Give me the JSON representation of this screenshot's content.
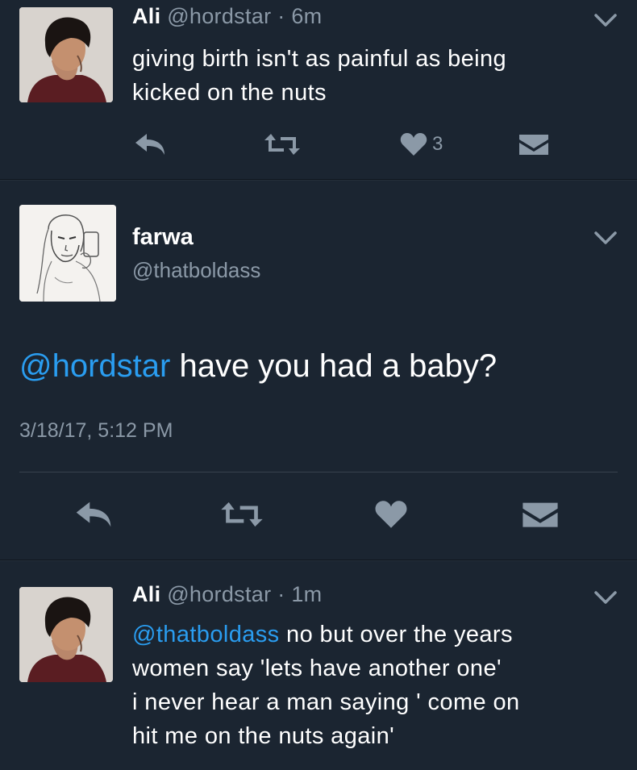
{
  "tweet1": {
    "name": "Ali",
    "handle": "@hordstar",
    "separator": "·",
    "time": "6m",
    "text_lines": [
      "giving birth isn't as painful as being",
      "kicked on the nuts"
    ],
    "like_count": "3"
  },
  "tweet2": {
    "name": "farwa",
    "handle": "@thatboldass",
    "mention": "@hordstar",
    "text": " have you had a baby?",
    "timestamp": "3/18/17, 5:12 PM"
  },
  "tweet3": {
    "name": "Ali",
    "handle": "@hordstar",
    "separator": "·",
    "time": "1m",
    "mention": "@thatboldass",
    "text_line1": " no but over the years",
    "text_lines": [
      "women say 'lets have another one'",
      "i never hear a man saying ' come on",
      "hit me on the nuts again'"
    ]
  },
  "icons": {
    "reply": "reply-icon",
    "retweet": "retweet-icon",
    "like": "heart-icon",
    "dm": "direct-message-icon",
    "more": "chevron-down-icon"
  },
  "colors": {
    "background": "#1b2531",
    "mention": "#2a9df0",
    "muted": "#8b99a7",
    "icon": "#8b99a7"
  }
}
